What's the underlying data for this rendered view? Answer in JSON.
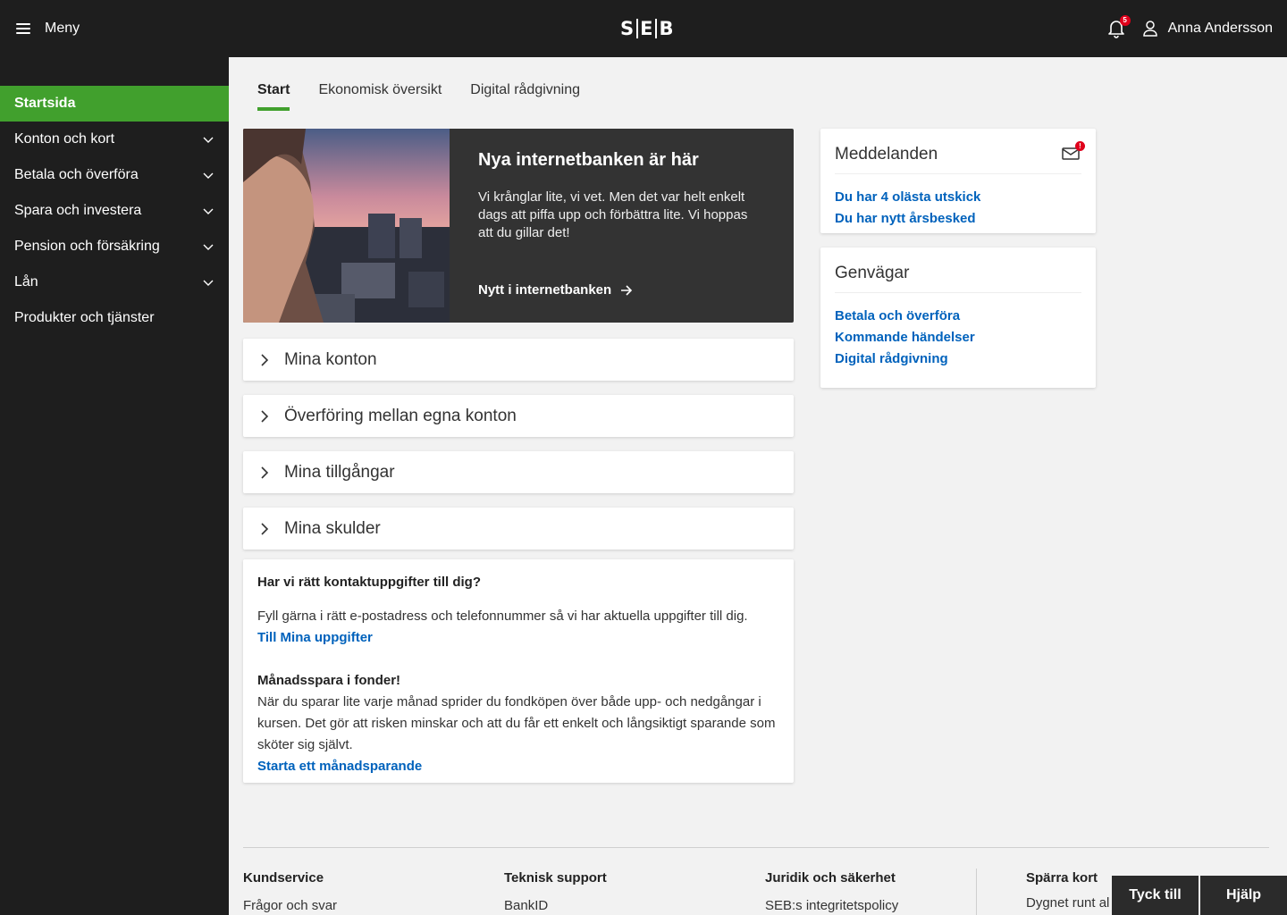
{
  "header": {
    "menu_label": "Meny",
    "logo_text_left": "S",
    "logo_text_mid": "E",
    "logo_text_right": "B",
    "notification_count": "5",
    "user_name": "Anna Andersson"
  },
  "sidebar": {
    "items": [
      {
        "label": "Startsida",
        "active": true
      },
      {
        "label": "Konton och kort"
      },
      {
        "label": "Betala och överföra"
      },
      {
        "label": "Spara och investera"
      },
      {
        "label": "Pension och försäkring"
      },
      {
        "label": "Lån"
      },
      {
        "label": "Produkter och tjänster"
      }
    ]
  },
  "tabs": [
    "Start",
    "Ekonomisk översikt",
    "Digital rådgivning"
  ],
  "hero": {
    "title": "Nya internetbanken är här",
    "text": "Vi krånglar lite, vi vet. Men det var helt enkelt dags att piffa upp och förbättra lite. Vi hoppas att du gillar det!",
    "link": "Nytt i internetbanken"
  },
  "accordions": [
    "Mina konton",
    "Överföring mellan egna konton",
    "Mina tillgångar",
    "Mina skulder"
  ],
  "info": {
    "h1": "Har vi rätt kontaktuppgifter till dig?",
    "p1": "Fyll gärna i rätt e-postadress och telefonnummer så vi har aktuella uppgifter till dig.",
    "l1": "Till Mina uppgifter",
    "h2": "Månadsspara i fonder!",
    "p2": "När du sparar lite varje månad sprider du fondköpen över både upp- och nedgångar i kursen. Det gör att risken minskar och att du får ett enkelt och långsiktigt sparande som sköter sig självt.",
    "l2": "Starta ett månadsparande"
  },
  "messages": {
    "title": "Meddelanden",
    "badge": "!",
    "links": [
      "Du har 4 olästa utskick",
      "Du har nytt årsbesked"
    ]
  },
  "shortcuts": {
    "title": "Genvägar",
    "links": [
      "Betala och överföra",
      "Kommande händelser",
      "Digital rådgivning"
    ]
  },
  "footer": {
    "cols": [
      {
        "heading": "Kundservice",
        "link": "Frågor och svar"
      },
      {
        "heading": "Teknisk support",
        "link": "BankID"
      },
      {
        "heading": "Juridik och säkerhet",
        "link": "SEB:s integritetspolicy"
      },
      {
        "heading": "Spärra kort",
        "link": "Dygnet runt al"
      }
    ]
  },
  "floating": {
    "feedback": "Tyck till",
    "help": "Hjälp"
  },
  "colors": {
    "accent": "#41a02d",
    "link": "#0062bc",
    "dark": "#1e1e1e",
    "alert": "#e0001b"
  }
}
